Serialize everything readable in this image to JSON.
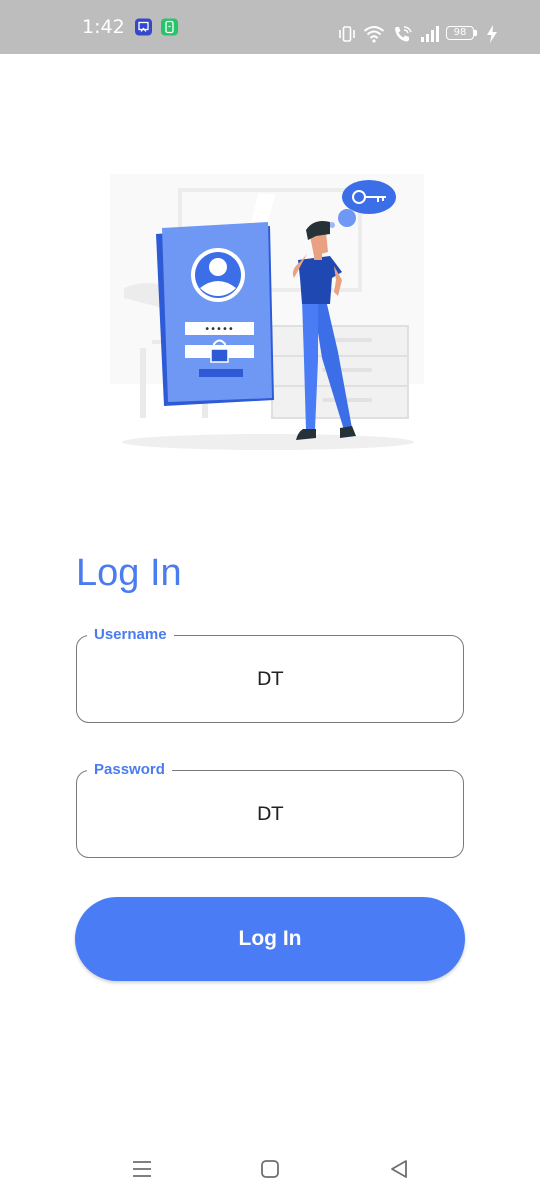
{
  "status_bar": {
    "time": "1:42",
    "battery_level": "98",
    "icons": [
      "app-notification-icon-blue",
      "app-notification-icon-green",
      "vibrate-icon",
      "wifi-icon",
      "wifi-calling-icon",
      "signal-icon",
      "battery-icon",
      "charging-icon"
    ]
  },
  "illustration": {
    "password_dots": "•••••"
  },
  "login": {
    "title": "Log In",
    "username_label": "Username",
    "username_value": "DT",
    "password_label": "Password",
    "password_value": "DT",
    "button_label": "Log In"
  },
  "nav_bar": {
    "icons": [
      "menu-icon",
      "home-icon",
      "back-icon"
    ]
  },
  "colors": {
    "accent": "#4a7cf0",
    "button": "#4a7cf5",
    "status_bar": "#bdbdbd",
    "field_border": "#7a7a7a"
  }
}
